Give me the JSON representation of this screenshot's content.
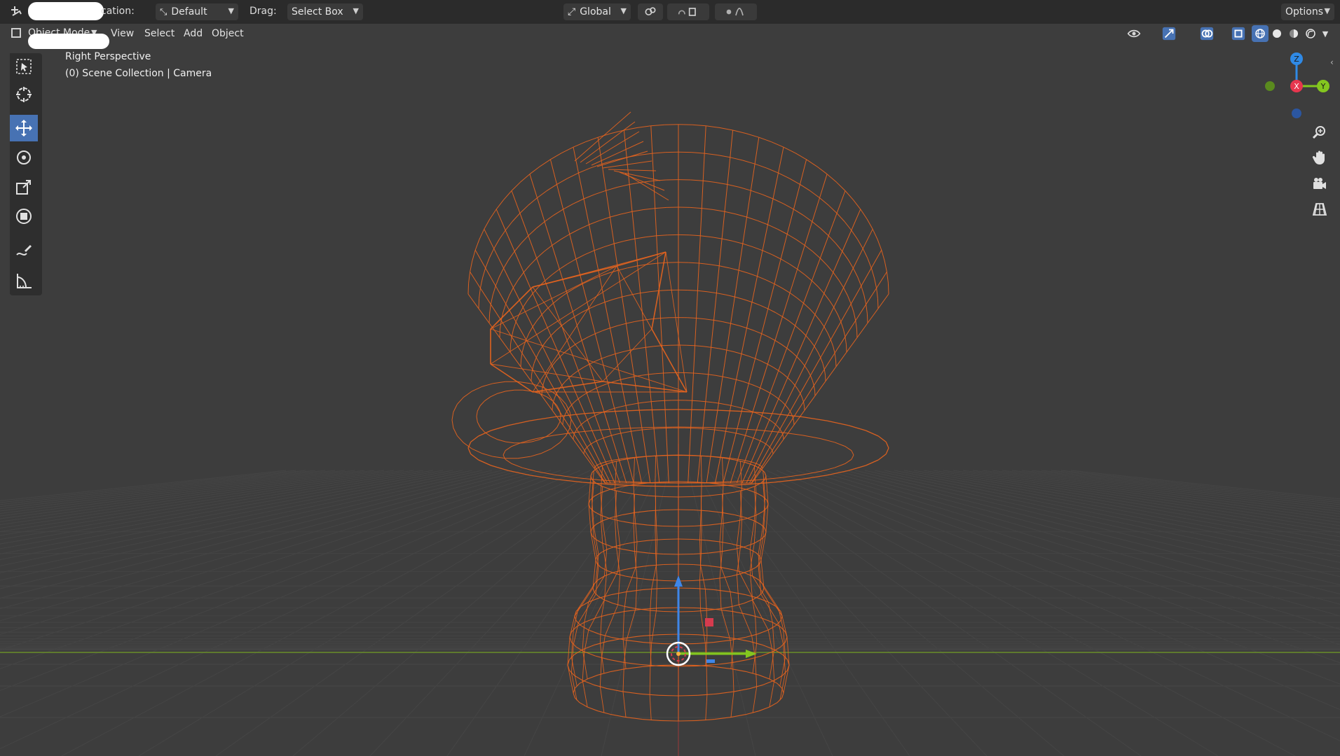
{
  "topbar": {
    "orientation_label": "cation:",
    "orientation_value": "Default",
    "drag_label": "Drag:",
    "drag_value": "Select Box",
    "transform_orientation": "Global",
    "options_label": "Options"
  },
  "header": {
    "mode": "Object Mode",
    "menus": [
      "View",
      "Select",
      "Add",
      "Object"
    ]
  },
  "viewport": {
    "view_name": "Right Perspective",
    "collection_info": "(0) Scene Collection | Camera"
  },
  "gizmo": {
    "z_label": "Z",
    "x_label": "X",
    "y_label": "Y"
  },
  "colors": {
    "wireframe": "#e8641e",
    "active_tool": "#4772b3",
    "axis_x": "#e6364e",
    "axis_y": "#84c71f",
    "axis_z": "#2f8ae6"
  },
  "tools": [
    "select-box-icon",
    "cursor-icon",
    "move-icon",
    "rotate-icon",
    "scale-icon",
    "transform-icon",
    "annotate-icon",
    "measure-icon"
  ],
  "active_tool": "move"
}
